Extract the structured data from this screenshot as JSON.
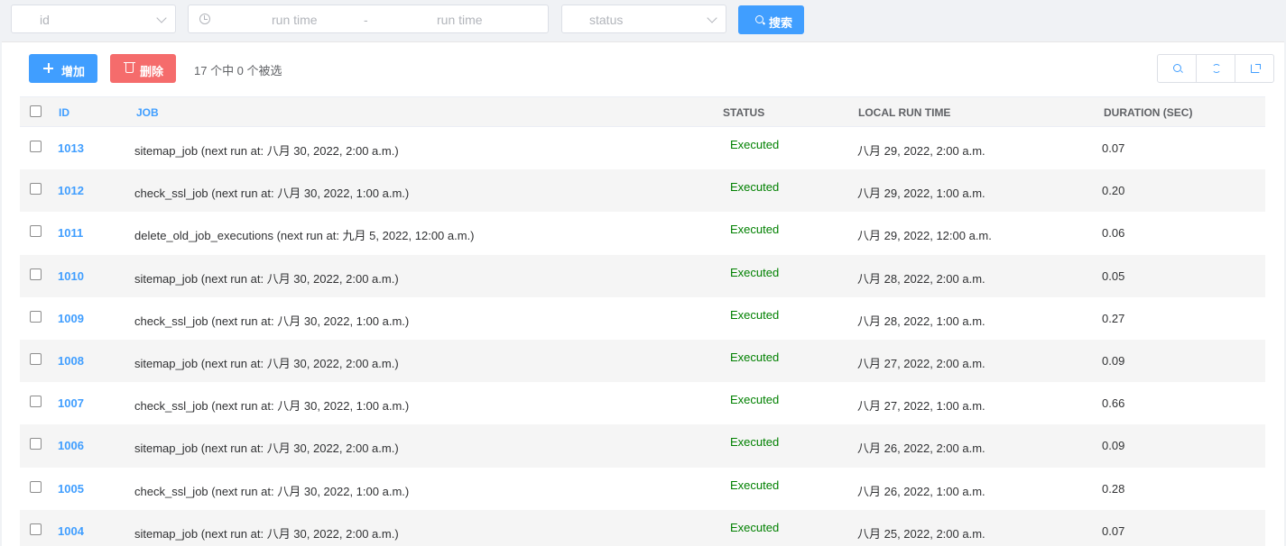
{
  "filters": {
    "id_placeholder": "id",
    "run_time_start_placeholder": "run time",
    "range_separator": "-",
    "run_time_end_placeholder": "run time",
    "status_placeholder": "status",
    "search_label": "搜索"
  },
  "toolbar": {
    "add_label": "增加",
    "delete_label": "删除",
    "selection_info": "17 个中 0 个被选",
    "icons": [
      "search-icon",
      "refresh-icon",
      "export-icon"
    ]
  },
  "table": {
    "columns": [
      "ID",
      "JOB",
      "STATUS",
      "LOCAL RUN TIME",
      "DURATION (SEC)"
    ],
    "rows": [
      {
        "id": "1013",
        "job": "sitemap_job (next run at: 八月 30, 2022, 2:00 a.m.)",
        "status": "Executed",
        "local_run_time": "八月 29, 2022, 2:00 a.m.",
        "duration": "0.07"
      },
      {
        "id": "1012",
        "job": "check_ssl_job (next run at: 八月 30, 2022, 1:00 a.m.)",
        "status": "Executed",
        "local_run_time": "八月 29, 2022, 1:00 a.m.",
        "duration": "0.20"
      },
      {
        "id": "1011",
        "job": "delete_old_job_executions (next run at: 九月 5, 2022, 12:00 a.m.)",
        "status": "Executed",
        "local_run_time": "八月 29, 2022, 12:00 a.m.",
        "duration": "0.06"
      },
      {
        "id": "1010",
        "job": "sitemap_job (next run at: 八月 30, 2022, 2:00 a.m.)",
        "status": "Executed",
        "local_run_time": "八月 28, 2022, 2:00 a.m.",
        "duration": "0.05"
      },
      {
        "id": "1009",
        "job": "check_ssl_job (next run at: 八月 30, 2022, 1:00 a.m.)",
        "status": "Executed",
        "local_run_time": "八月 28, 2022, 1:00 a.m.",
        "duration": "0.27"
      },
      {
        "id": "1008",
        "job": "sitemap_job (next run at: 八月 30, 2022, 2:00 a.m.)",
        "status": "Executed",
        "local_run_time": "八月 27, 2022, 2:00 a.m.",
        "duration": "0.09"
      },
      {
        "id": "1007",
        "job": "check_ssl_job (next run at: 八月 30, 2022, 1:00 a.m.)",
        "status": "Executed",
        "local_run_time": "八月 27, 2022, 1:00 a.m.",
        "duration": "0.66"
      },
      {
        "id": "1006",
        "job": "sitemap_job (next run at: 八月 30, 2022, 2:00 a.m.)",
        "status": "Executed",
        "local_run_time": "八月 26, 2022, 2:00 a.m.",
        "duration": "0.09"
      },
      {
        "id": "1005",
        "job": "check_ssl_job (next run at: 八月 30, 2022, 1:00 a.m.)",
        "status": "Executed",
        "local_run_time": "八月 26, 2022, 1:00 a.m.",
        "duration": "0.28"
      },
      {
        "id": "1004",
        "job": "sitemap_job (next run at: 八月 30, 2022, 2:00 a.m.)",
        "status": "Executed",
        "local_run_time": "八月 25, 2022, 2:00 a.m.",
        "duration": "0.07"
      }
    ]
  },
  "colors": {
    "primary": "#409eff",
    "danger": "#f56c6c",
    "status_executed": "#008000"
  }
}
